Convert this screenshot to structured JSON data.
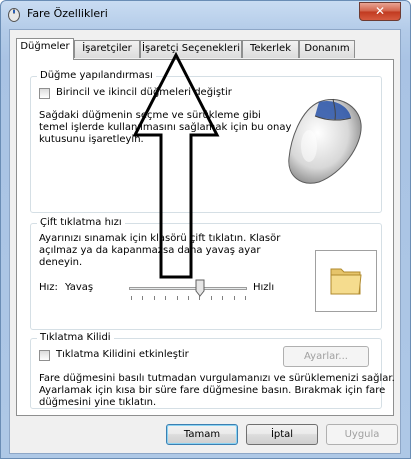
{
  "window": {
    "title": "Fare Özellikleri",
    "close_label": "✕"
  },
  "tabs": [
    {
      "label": "Düğmeler",
      "active": true
    },
    {
      "label": "İşaretçiler",
      "active": false
    },
    {
      "label": "İşaretçi Seçenekleri",
      "active": false
    },
    {
      "label": "Tekerlek",
      "active": false
    },
    {
      "label": "Donanım",
      "active": false
    }
  ],
  "button_config": {
    "title": "Düğme yapılandırması",
    "checkbox_label": "Birincil ve ikincil düğmeleri değiştir",
    "checked": false,
    "description": [
      "Sağdaki düğmenin seçme ve sürükleme gibi",
      "temel işlerde kullanılmasını sağlamak için bu onay",
      "kutusunu işaretleyin."
    ]
  },
  "double_click": {
    "title": "Çift tıklatma hızı",
    "description": [
      "Ayarınızı sınamak için klasörü çift tıklatın. Klasör",
      "açılmaz ya da kapanmazsa daha yavaş ayar",
      "deneyin."
    ],
    "speed_label": "Hız:",
    "slow_label": "Yavaş",
    "fast_label": "Hızlı",
    "speed_value": 0.6
  },
  "click_lock": {
    "title": "Tıklatma Kilidi",
    "checkbox_label": "Tıklatma Kilidini etkinleştir",
    "checked": false,
    "settings_label": "Ayarlar...",
    "description": [
      "Fare düğmesini basılı tutmadan vurgulamanızı ve sürüklemenizi sağlar.",
      "Ayarlamak için kısa bir süre fare düğmesine basın. Bırakmak için fare",
      "düğmesini yine tıklatın."
    ]
  },
  "footer": {
    "ok_label": "Tamam",
    "cancel_label": "İptal",
    "apply_label": "Uygula"
  },
  "colors": {
    "accent_blue": "#3c7fb1",
    "close_red": "#c1391f"
  }
}
